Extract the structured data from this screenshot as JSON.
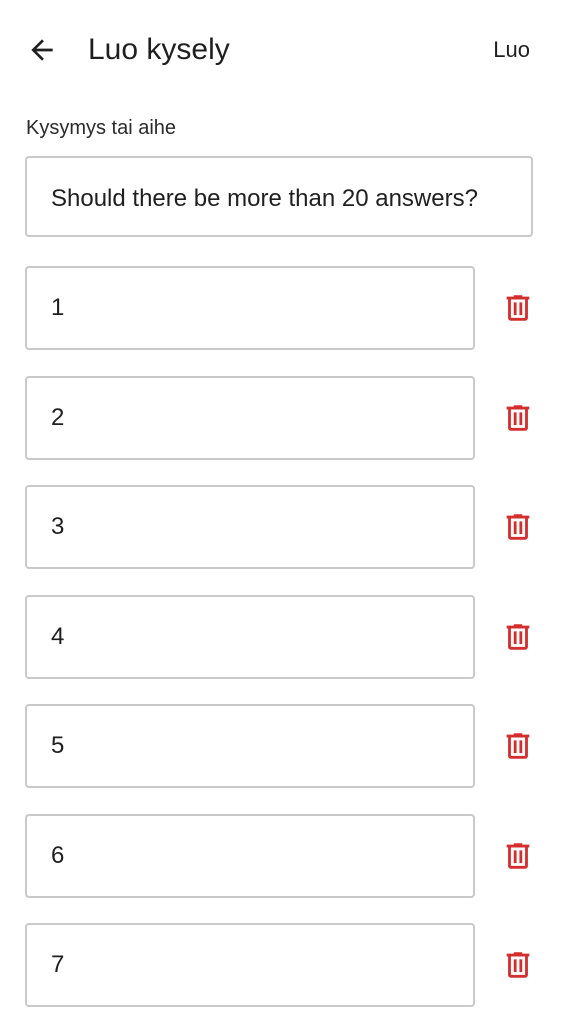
{
  "app_bar": {
    "back_icon": "arrow-left-icon",
    "title": "Luo kysely",
    "action_label": "Luo"
  },
  "form": {
    "question_label": "Kysymys tai aihe",
    "question_value": "Should there be more than 20 answers?"
  },
  "answers": [
    {
      "value": "1",
      "delete_icon": "trash-icon"
    },
    {
      "value": "2",
      "delete_icon": "trash-icon"
    },
    {
      "value": "3",
      "delete_icon": "trash-icon"
    },
    {
      "value": "4",
      "delete_icon": "trash-icon"
    },
    {
      "value": "5",
      "delete_icon": "trash-icon"
    },
    {
      "value": "6",
      "delete_icon": "trash-icon"
    },
    {
      "value": "7",
      "delete_icon": "trash-icon"
    }
  ],
  "colors": {
    "delete_icon": "#d32f2f",
    "field_border": "#c9c9c9",
    "text": "#1f1f1f"
  }
}
